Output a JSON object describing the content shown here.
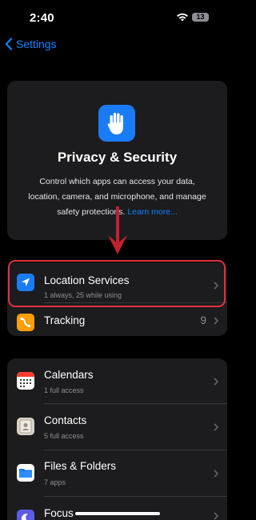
{
  "status_bar": {
    "time": "2:40",
    "battery_level": "13",
    "icons": [
      "wifi-icon",
      "battery-icon"
    ]
  },
  "nav": {
    "back_label": "Settings",
    "back_icon": "chevron-left-icon"
  },
  "hero": {
    "icon": "raised-hand-icon",
    "title": "Privacy & Security",
    "description": "Control which apps can access your data, location, camera, and microphone, and manage safety protections.",
    "link_text": "Learn more..."
  },
  "annotation": {
    "arrow_color": "#c0212f",
    "highlight_color": "#e0303f"
  },
  "group_a": [
    {
      "title": "Location Services",
      "subtitle": "1 always, 25 while using",
      "icon": "location-arrow-icon",
      "icon_bg": "#1a7cf5"
    },
    {
      "title": "Tracking",
      "value": "9",
      "icon": "tracking-icon",
      "icon_bg": "#ff9f0a"
    }
  ],
  "group_b": [
    {
      "title": "Calendars",
      "subtitle": "1 full access",
      "icon": "calendar-icon"
    },
    {
      "title": "Contacts",
      "subtitle": "5 full access",
      "icon": "contacts-icon"
    },
    {
      "title": "Files & Folders",
      "subtitle": "7 apps",
      "icon": "folder-icon",
      "icon_bg": "#1a7cf5"
    },
    {
      "title": "Focus",
      "icon": "moon-icon",
      "icon_bg": "#5e5ce6"
    }
  ],
  "colors": {
    "accent": "#0a84ff",
    "background": "#000000",
    "card": "#1c1c1e"
  }
}
